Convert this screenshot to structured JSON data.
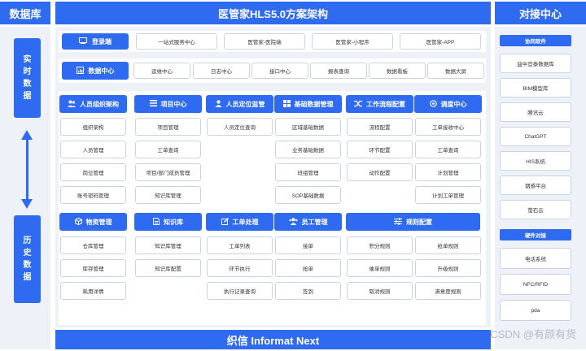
{
  "headers": {
    "left": "数据库",
    "center": "医管家HLS5.0方案架构",
    "right": "对接中心",
    "footer": "织信 Informat Next"
  },
  "left_col": {
    "top": "实时数据",
    "bottom": "历史数据"
  },
  "login": {
    "label": "登录端",
    "items": [
      "一站式服务中心",
      "医管家-医院端",
      "医管家-小程序",
      "医管家-APP"
    ]
  },
  "data_center": {
    "label": "数据中心",
    "items": [
      "运维中心",
      "日志中心",
      "接口中心",
      "报表查询",
      "数据看板",
      "数据大屏"
    ]
  },
  "modules_row1": [
    {
      "label": "人员组织架构",
      "icon": "people-icon",
      "items": [
        "组织架构",
        "人员管理",
        "岗位管理",
        "账号密码管理"
      ]
    },
    {
      "label": "项目中心",
      "icon": "list-icon",
      "items": [
        "项目管理",
        "工单查询",
        "项目/部门成员管理",
        "知识库管理"
      ]
    },
    {
      "label": "人员定位监管",
      "icon": "person-pin-icon",
      "items": [
        "人员定位查询"
      ]
    },
    {
      "label": "基础数据管理",
      "icon": "grid-icon",
      "items": [
        "区域基础数据",
        "业务基础数据",
        "班组管理",
        "SOP基础数据"
      ]
    },
    {
      "label": "工作流程配置",
      "icon": "shuffle-icon",
      "items": [
        "流程配置",
        "环节配置",
        "动作配置"
      ]
    },
    {
      "label": "调度中心",
      "icon": "dispatch-icon",
      "items": [
        "工单接收中心",
        "工单查询",
        "计划管理",
        "计划工单管理"
      ]
    }
  ],
  "modules_row2": [
    {
      "label": "物资管理",
      "icon": "box-icon",
      "items": [
        "仓库管理",
        "库存管理",
        "耗用详情"
      ]
    },
    {
      "label": "知识库",
      "icon": "book-icon",
      "items": [
        "知识库管理",
        "知识库配置"
      ]
    },
    {
      "label": "工单处理",
      "icon": "edit-icon",
      "items": [
        "工单列表",
        "环节执行",
        "执行记录查询"
      ]
    },
    {
      "label": "员工管理",
      "icon": "team-icon",
      "items": [
        "接单",
        "抢单",
        "签到"
      ]
    }
  ],
  "rules": {
    "label": "规则配置",
    "icon": "sliders-icon",
    "left": [
      "积分规则",
      "催单规则",
      "取消规则"
    ],
    "right": [
      "抢单规则",
      "升级规则",
      "满意度规则"
    ]
  },
  "right_col": {
    "software_label": "协同软件",
    "software": [
      "益中亘泰数据库",
      "BIM模型库",
      "腾讯云",
      "ChatGPT",
      "HIS系统",
      "烟感平台",
      "萤石云"
    ],
    "hardware_label": "硬件对接",
    "hardware": [
      "电话系统",
      "NFC/RFID",
      "pda"
    ]
  },
  "watermark": "CSDN @有颜有货"
}
